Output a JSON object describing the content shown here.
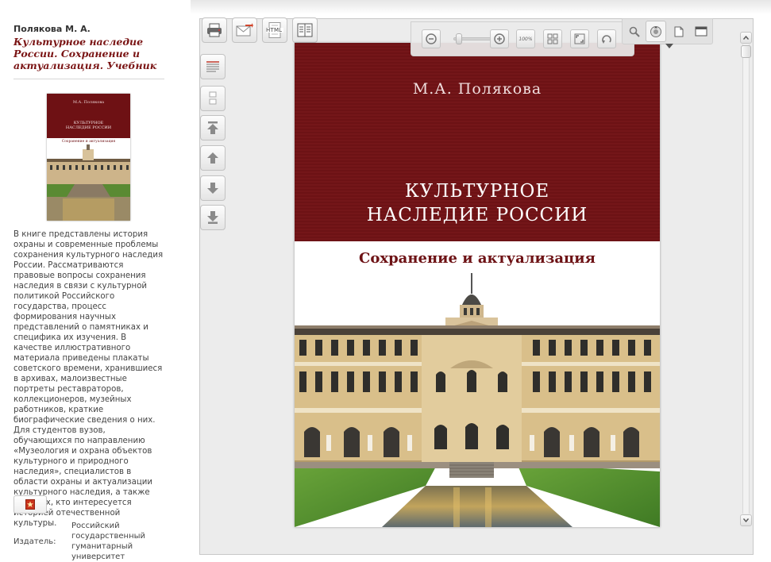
{
  "book": {
    "author": "Полякова М. А.",
    "title": "Культурное наследие России. Сохранение и актуализация. Учебник",
    "description": "В книге представлены история охраны и современные проблемы сохранения культурного наследия России. Рассматриваются правовые вопросы сохранения наследия в связи с культурной политикой Российского государства, процесс формирования научных представлений о памятниках и специфика их изучения. В качестве иллюстративного материала приведены плакаты советского времени, хранившиеся в архивах, малоизвестные портреты реставраторов, коллекционеров, музейных работников, краткие биографические сведения о них. Для студентов вузов, обучающихся по направлению «Музеология и охрана объектов культурного и природного наследия», специалистов в области охраны и актуализации культурного наследия, а также для всех, кто интересуется историей отечественной культуры.",
    "publisher_label": "Издатель:",
    "publisher": "Российский государственный гуманитарный университет"
  },
  "cover": {
    "author": "М.А. Полякова",
    "title_line1": "КУЛЬТУРНОЕ",
    "title_line2": "НАСЛЕДИЕ РОССИИ",
    "subtitle": "Сохранение и актуализация"
  },
  "thumb": {
    "author": "М.А. Полякова",
    "title_line1": "КУЛЬТУРНОЕ",
    "title_line2": "НАСЛЕДИЕ РОССИИ",
    "subtitle": "Сохранение и актуализация"
  },
  "toolbar": {
    "html_label": "HTML",
    "zoom_100_label": "100%",
    "zoom_level_fraction": 0.05
  },
  "icons": {
    "print": "print-icon",
    "email": "email-icon",
    "html": "html-export-icon",
    "contents": "table-of-contents-icon",
    "search": "search-icon",
    "hand": "hand-tool-icon",
    "single_page": "single-page-icon",
    "fullscreen": "window-mode-icon"
  },
  "colors": {
    "accent": "#6d1215",
    "title_text": "#7a1414",
    "viewer_bg": "#ececec"
  }
}
